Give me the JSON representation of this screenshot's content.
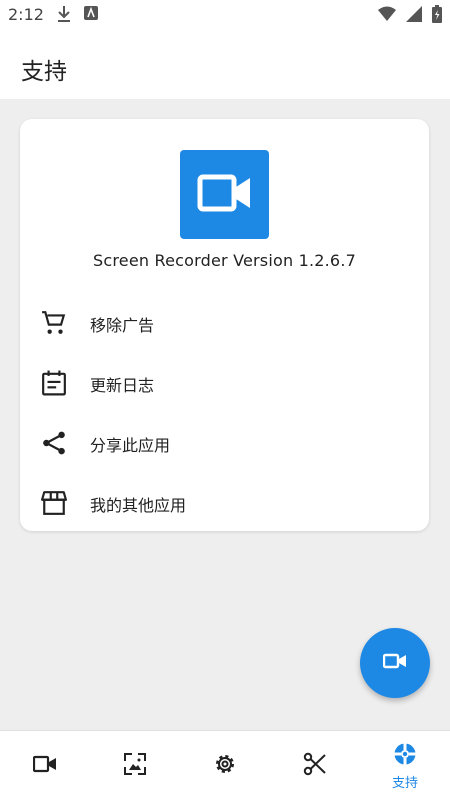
{
  "status_bar": {
    "time": "2:12",
    "icons": [
      "download-icon",
      "android-icon",
      "wifi-icon",
      "signal-icon",
      "battery-icon"
    ]
  },
  "app_bar": {
    "title": "支持"
  },
  "card": {
    "logo_icon": "video-camera-icon",
    "version_text": "Screen Recorder Version 1.2.6.7",
    "menu": [
      {
        "label": "移除广告",
        "icon": "cart-icon"
      },
      {
        "label": "更新日志",
        "icon": "calendar-icon"
      },
      {
        "label": "分享此应用",
        "icon": "share-icon"
      },
      {
        "label": "我的其他应用",
        "icon": "store-icon"
      }
    ]
  },
  "fab": {
    "icon": "video-camera-icon"
  },
  "bottom_nav": {
    "items": [
      {
        "icon": "video-camera-icon",
        "label": ""
      },
      {
        "icon": "image-icon",
        "label": ""
      },
      {
        "icon": "gear-icon",
        "label": ""
      },
      {
        "icon": "scissors-icon",
        "label": ""
      },
      {
        "icon": "lifebuoy-icon",
        "label": "支持",
        "active": true
      }
    ]
  },
  "colors": {
    "accent": "#1e88e5",
    "icon": "#222222",
    "background": "#eeeeee"
  }
}
